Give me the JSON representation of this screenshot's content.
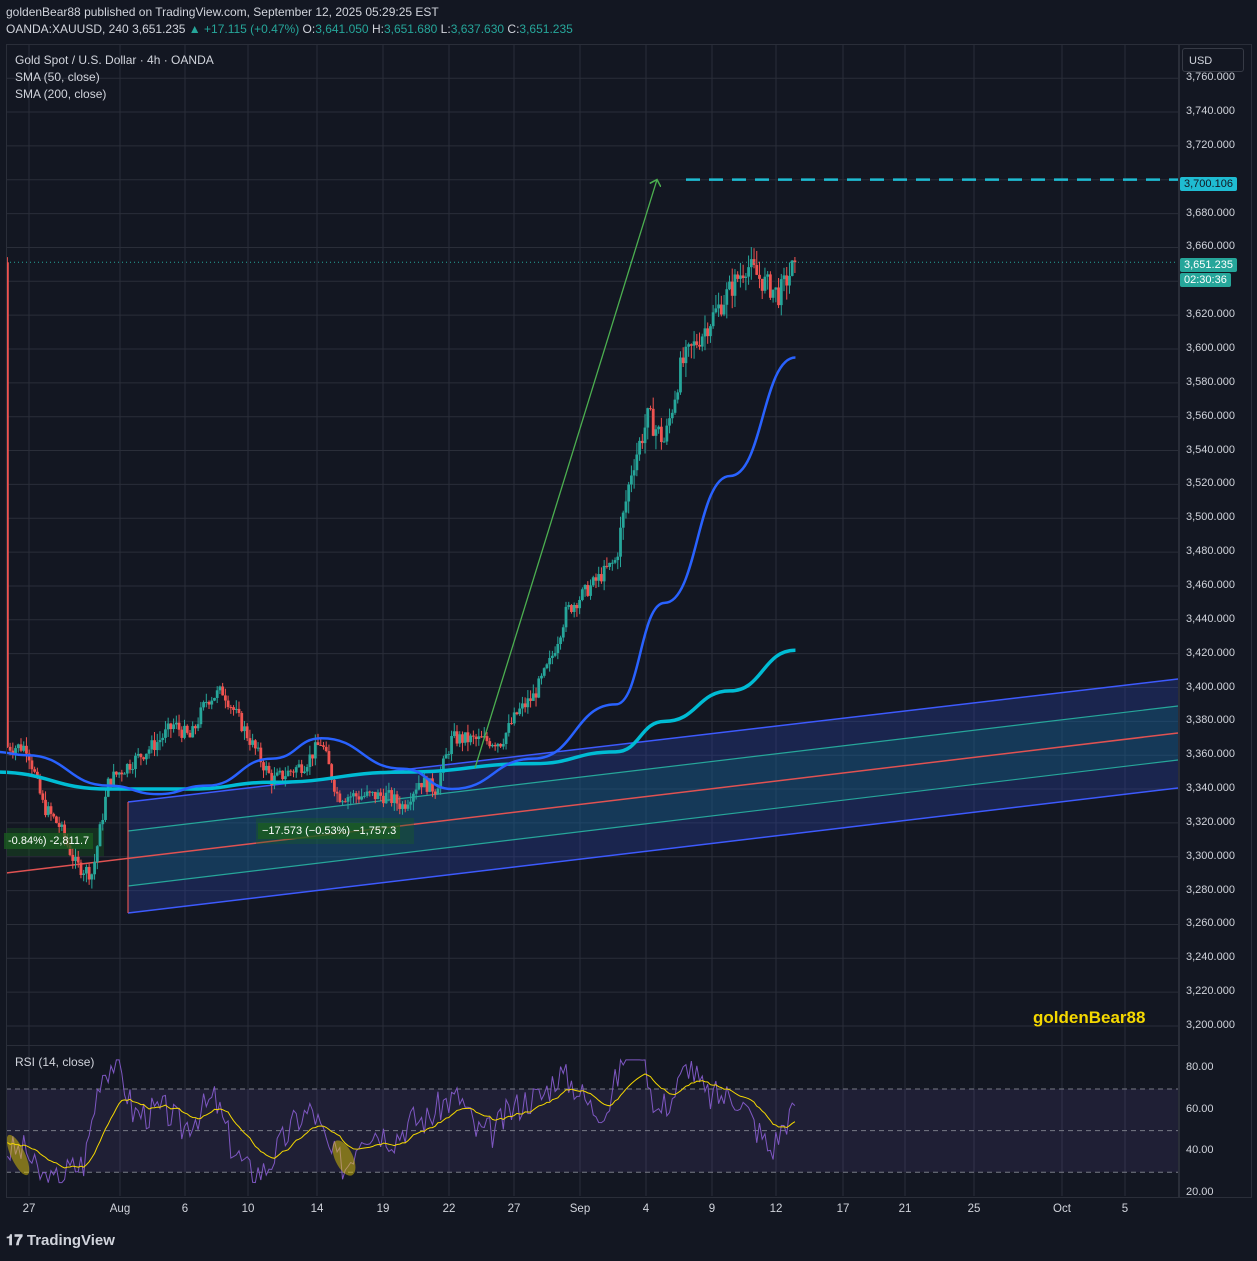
{
  "header": {
    "publisher_line": "goldenBear88 published on TradingView.com, September 12, 2025 05:29:25 EST",
    "symbol": "OANDA:XAUUSD, 240",
    "price": "3,651.235",
    "change": "▲ +17.115 (+0.47%)",
    "o_label": "O:",
    "o_value": "3,641.050",
    "h_label": "H:",
    "h_value": "3,651.680",
    "l_label": "L:",
    "l_value": "3,637.630",
    "c_label": "C:",
    "c_value": "3,651.235"
  },
  "legend": {
    "title": "Gold Spot / U.S. Dollar · 4h · OANDA",
    "sma50": "SMA (50, close)",
    "sma200": "SMA (200, close)"
  },
  "currency_button": "USD",
  "price_tags": {
    "target": "3,700.106",
    "last_price": "3,651.235",
    "countdown": "02:30:36"
  },
  "measure_labels": {
    "left": "-0.84%) -2,811.7",
    "middle": "−17.573 (−0.53%) −1,757.3"
  },
  "watermark": "goldenBear88",
  "brand": "TradingView",
  "rsi": {
    "title": "RSI (14, close)"
  },
  "colors": {
    "up": "#26a69a",
    "down": "#ef5350",
    "sma50": "#2962ff",
    "sma200": "#00bcd4",
    "target_line": "#1fbcd2",
    "arrow": "#4caf50",
    "channel_edge": "#3d5afe",
    "channel_mid": "#e05252",
    "rsi_line": "#7e57c2",
    "rsi_ma": "#f5d800"
  },
  "chart_data": {
    "type": "candlestick",
    "title": "Gold Spot / U.S. Dollar · 4h · OANDA",
    "y_axis": {
      "ticks": [
        "3,200.000",
        "3,220.000",
        "3,240.000",
        "3,260.000",
        "3,280.000",
        "3,300.000",
        "3,320.000",
        "3,340.000",
        "3,360.000",
        "3,380.000",
        "3,400.000",
        "3,420.000",
        "3,440.000",
        "3,460.000",
        "3,480.000",
        "3,500.000",
        "3,520.000",
        "3,540.000",
        "3,560.000",
        "3,580.000",
        "3,600.000",
        "3,620.000",
        "3,640.000",
        "3,660.000",
        "3,680.000",
        "3,700.000",
        "3,720.000",
        "3,740.000",
        "3,760.000"
      ],
      "range": [
        3190,
        3775
      ]
    },
    "x_axis": {
      "ticks": [
        "27",
        "Aug",
        "6",
        "10",
        "14",
        "19",
        "22",
        "27",
        "Sep",
        "4",
        "9",
        "12",
        "17",
        "21",
        "25",
        "Oct",
        "5"
      ]
    },
    "close_path": [
      [
        "Jul 27",
        3365
      ],
      [
        "Jul 28",
        3330
      ],
      [
        "Jul 29",
        3318
      ],
      [
        "Jul 30",
        3295
      ],
      [
        "Jul 31",
        3290
      ],
      [
        "Aug 1",
        3345
      ],
      [
        "Aug 4",
        3368
      ],
      [
        "Aug 5",
        3378
      ],
      [
        "Aug 6",
        3370
      ],
      [
        "Aug 7",
        3393
      ],
      [
        "Aug 8",
        3398
      ],
      [
        "Aug 11",
        3345
      ],
      [
        "Aug 12",
        3350
      ],
      [
        "Aug 13",
        3355
      ],
      [
        "Aug 14",
        3368
      ],
      [
        "Aug 15",
        3336
      ],
      [
        "Aug 18",
        3336
      ],
      [
        "Aug 19",
        3330
      ],
      [
        "Aug 20",
        3345
      ],
      [
        "Aug 21",
        3340
      ],
      [
        "Aug 22",
        3370
      ],
      [
        "Aug 25",
        3368
      ],
      [
        "Aug 26",
        3385
      ],
      [
        "Aug 27",
        3395
      ],
      [
        "Aug 28",
        3415
      ],
      [
        "Aug 29",
        3445
      ],
      [
        "Sep 1",
        3475
      ],
      [
        "Sep 2",
        3530
      ],
      [
        "Sep 3",
        3560
      ],
      [
        "Sep 4",
        3545
      ],
      [
        "Sep 5",
        3590
      ],
      [
        "Sep 8",
        3635
      ],
      [
        "Sep 9",
        3650
      ],
      [
        "Sep 10",
        3640
      ],
      [
        "Sep 11",
        3632
      ],
      [
        "Sep 12",
        3651.235
      ]
    ],
    "last": {
      "open": 3641.05,
      "high": 3651.68,
      "low": 3637.63,
      "close": 3651.235,
      "change": 17.115,
      "change_pct": 0.47
    },
    "target_level": 3700.106,
    "sma50_path": [
      [
        "Jul 25",
        3362
      ],
      [
        "Jul 27",
        3360
      ],
      [
        "Aug 1",
        3342
      ],
      [
        "Aug 4",
        3337
      ],
      [
        "Aug 7",
        3342
      ],
      [
        "Aug 11",
        3358
      ],
      [
        "Aug 14",
        3370
      ],
      [
        "Aug 19",
        3352
      ],
      [
        "Aug 22",
        3340
      ],
      [
        "Aug 27",
        3358
      ],
      [
        "Sep 1",
        3390
      ],
      [
        "Sep 4",
        3450
      ],
      [
        "Sep 8",
        3525
      ],
      [
        "Sep 12",
        3595
      ]
    ],
    "sma200_path": [
      [
        "Jul 25",
        3350
      ],
      [
        "Aug 1",
        3340
      ],
      [
        "Aug 6",
        3340
      ],
      [
        "Aug 11",
        3344
      ],
      [
        "Aug 19",
        3350
      ],
      [
        "Aug 27",
        3355
      ],
      [
        "Sep 1",
        3362
      ],
      [
        "Sep 4",
        3380
      ],
      [
        "Sep 8",
        3398
      ],
      [
        "Sep 12",
        3422
      ]
    ],
    "rsi": {
      "ticks": [
        "20.00",
        "40.00",
        "60.00",
        "80.00"
      ],
      "bands": [
        30,
        50,
        70
      ],
      "range": [
        20,
        85
      ],
      "last": 62
    }
  }
}
